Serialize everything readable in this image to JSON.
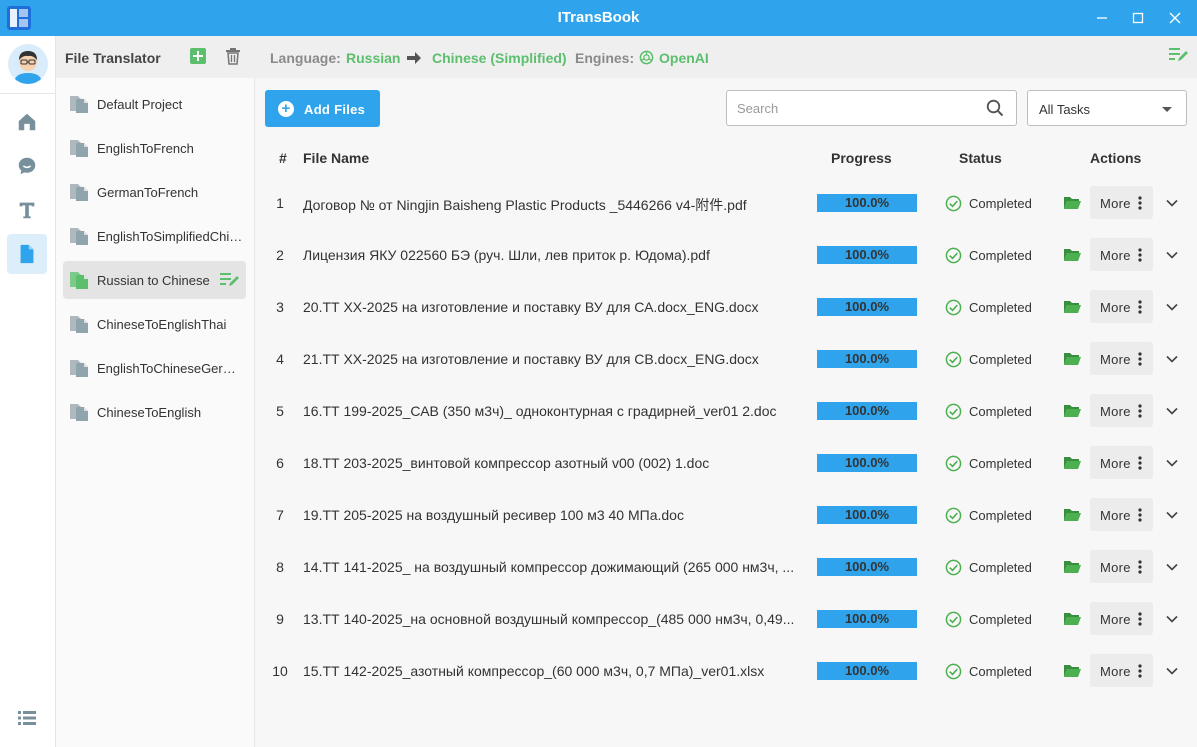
{
  "app": {
    "title": "ITransBook"
  },
  "sidebar": {
    "title": "File Translator",
    "projects": [
      {
        "label": "Default Project"
      },
      {
        "label": "EnglishToFrench"
      },
      {
        "label": "GermanToFrench"
      },
      {
        "label": "EnglishToSimplifiedChinese"
      },
      {
        "label": "Russian to Chinese",
        "active": true
      },
      {
        "label": "ChineseToEnglishThai"
      },
      {
        "label": "EnglishToChineseGerman"
      },
      {
        "label": "ChineseToEnglish"
      }
    ]
  },
  "header": {
    "language_label": "Language:",
    "source_language": "Russian",
    "target_language": "Chinese (Simplified)",
    "engines_label": "Engines:",
    "engine": "OpenAI"
  },
  "toolbar": {
    "add_files_label": "Add Files",
    "search_placeholder": "Search",
    "filter_value": "All Tasks"
  },
  "table": {
    "columns": {
      "num": "#",
      "file_name": "File Name",
      "progress": "Progress",
      "status": "Status",
      "actions": "Actions"
    },
    "more_label": "More",
    "rows": [
      {
        "num": "1",
        "file_name": "Договор № от Ningjin Baisheng Plastic Products _5446266 v4-附件.pdf",
        "progress": "100.0%",
        "status": "Completed"
      },
      {
        "num": "2",
        "file_name": "Лицензия ЯКУ 022560 БЭ (руч. Шли, лев приток р. Юдома).pdf",
        "progress": "100.0%",
        "status": "Completed"
      },
      {
        "num": "3",
        "file_name": "20.ТТ XX-2025 на изготовление и поставку ВУ для СА.docx_ENG.docx",
        "progress": "100.0%",
        "status": "Completed"
      },
      {
        "num": "4",
        "file_name": "21.ТТ XX-2025 на изготовление и поставку ВУ для СВ.docx_ENG.docx",
        "progress": "100.0%",
        "status": "Completed"
      },
      {
        "num": "5",
        "file_name": "16.ТТ 199-2025_САВ (350 м3ч)_ одноконтурная с градирней_ver01 2.doc",
        "progress": "100.0%",
        "status": "Completed"
      },
      {
        "num": "6",
        "file_name": "18.ТТ 203-2025_винтовой компрессор азотный v00 (002) 1.doc",
        "progress": "100.0%",
        "status": "Completed"
      },
      {
        "num": "7",
        "file_name": "19.ТТ 205-2025 на воздушный ресивер 100 м3 40 МПа.doc",
        "progress": "100.0%",
        "status": "Completed"
      },
      {
        "num": "8",
        "file_name": "14.ТТ 141-2025_ на воздушный компрессор дожимающий (265 000 нм3ч, ...",
        "progress": "100.0%",
        "status": "Completed"
      },
      {
        "num": "9",
        "file_name": "13.ТТ 140-2025_на основной воздушный компрессор_(485 000 нм3ч, 0,49...",
        "progress": "100.0%",
        "status": "Completed"
      },
      {
        "num": "10",
        "file_name": "15.ТТ 142-2025_азотный компрессор_(60 000 м3ч, 0,7 МПа)_ver01.xlsx",
        "progress": "100.0%",
        "status": "Completed"
      }
    ]
  },
  "colors": {
    "accent": "#2fa4ec",
    "green": "#5cbf6d",
    "status_green": "#4caf50",
    "folder_green": "#43a047"
  }
}
